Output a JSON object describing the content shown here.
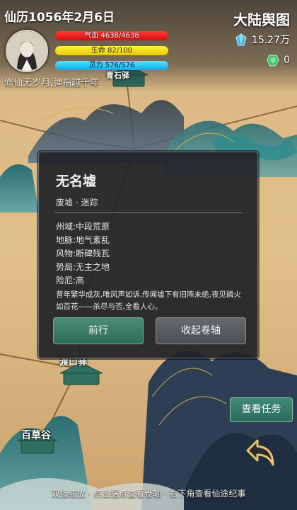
{
  "hud": {
    "date": "仙历1056年2月6日",
    "motto": "修仙无岁月,弹指越千年",
    "bars": {
      "hp": "气血 4638/4638",
      "life": "生命 82/100",
      "spirit": "灵力 576/576"
    }
  },
  "header": {
    "map_title": "大陆舆图",
    "resources": [
      {
        "icon": "blue-crystal-icon",
        "value": "15.27万"
      },
      {
        "icon": "green-jade-icon",
        "value": "0"
      }
    ]
  },
  "dialog": {
    "title": "无名墟",
    "subtitle": "废墟 · 迷踪",
    "attributes": [
      "州域:中段荒原",
      "地脉:地气紊乱",
      "风物:断碑残瓦",
      "势局:无主之地",
      "险厄:高"
    ],
    "description": "昔年繁华成灰,唯风声如诉,传闻墟下有旧阵未绝,夜见磷火如百花——杀尽与否,全看人心。",
    "go_label": "前行",
    "close_label": "收起卷轴"
  },
  "map_labels": {
    "mountain_temple": "青石驿",
    "ferry": "渡口驿",
    "valley": "百草谷"
  },
  "actions": {
    "task_label": "查看任务"
  },
  "hint": "双指缩放 · 点击据点查看卷轴 · 右下角查看仙途纪事",
  "colors": {
    "accent_green": "#3f8a74",
    "hp_red": "#e01818",
    "life_yellow": "#f2dc12",
    "spirit_blue": "#2bb8ee"
  }
}
